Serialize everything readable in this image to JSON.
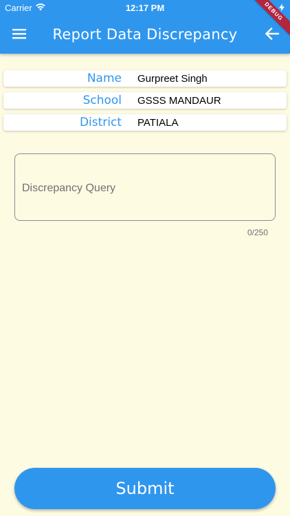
{
  "status_bar": {
    "carrier": "Carrier",
    "time": "12:17 PM",
    "debug_label": "DEBUG"
  },
  "app_bar": {
    "title": "Report Data Discrepancy",
    "menu_icon": "hamburger-menu-icon",
    "back_icon": "arrow-left-icon",
    "color": "#2f96ee"
  },
  "info": [
    {
      "label": "Name",
      "value": "Gurpreet Singh"
    },
    {
      "label": "School",
      "value": "GSSS MANDAUR"
    },
    {
      "label": "District",
      "value": "PATIALA"
    }
  ],
  "query": {
    "placeholder": "Discrepancy Query",
    "value": "",
    "counter": "0/250"
  },
  "submit_label": "Submit",
  "colors": {
    "accent": "#2f96ee",
    "background": "#fefbe3",
    "debug": "#b3263d"
  }
}
